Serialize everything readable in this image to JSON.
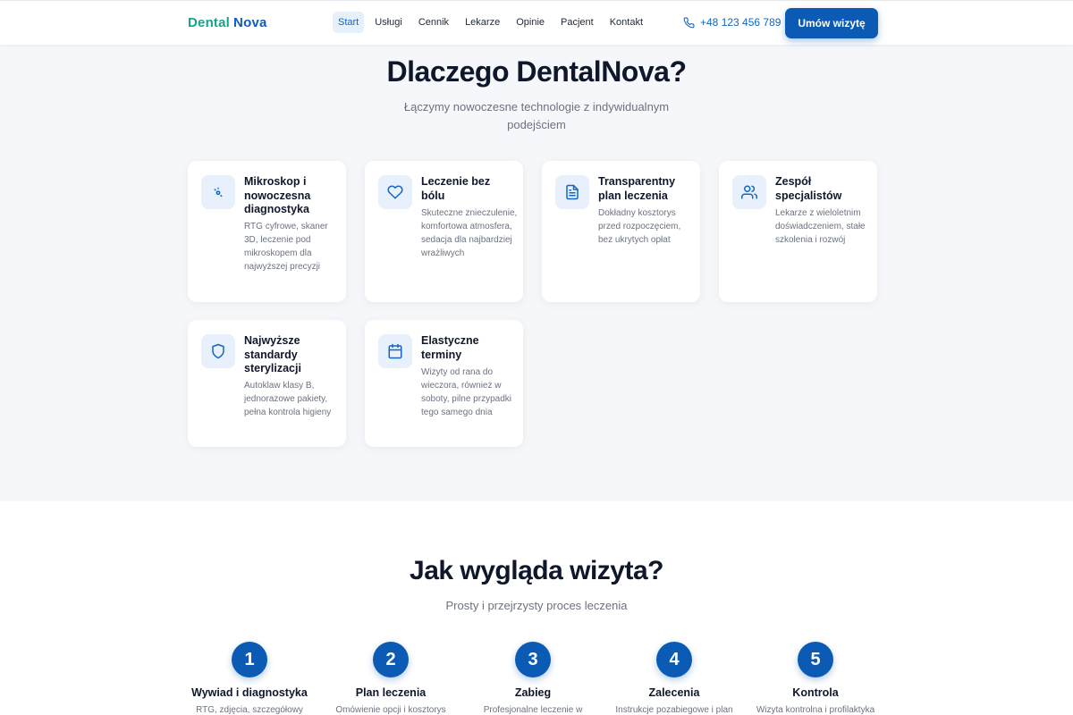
{
  "header": {
    "logo_part1": "Dental",
    "logo_part2": "Nova",
    "nav": [
      "Start",
      "Usługi",
      "Cennik",
      "Lekarze",
      "Opinie",
      "Pacjent",
      "Kontakt"
    ],
    "active_nav": "Start",
    "phone": "+48 123 456 789",
    "cta": "Umów wizytę"
  },
  "why": {
    "title": "Dlaczego DentalNova?",
    "subtitle": "Łączymy nowoczesne technologie z indywidualnym podejściem",
    "cards": [
      {
        "icon": "microscope-icon",
        "title": "Mikroskop i nowoczesna diagnostyka",
        "desc": "RTG cyfrowe, skaner 3D, leczenie pod mikroskopem dla najwyższej precyzji"
      },
      {
        "icon": "heart-icon",
        "title": "Leczenie bez bólu",
        "desc": "Skuteczne znieczulenie, komfortowa atmosfera, sedacja dla najbardziej wrażliwych"
      },
      {
        "icon": "document-icon",
        "title": "Transparentny plan leczenia",
        "desc": "Dokładny kosztorys przed rozpoczęciem, bez ukrytych opłat"
      },
      {
        "icon": "users-icon",
        "title": "Zespół specjalistów",
        "desc": "Lekarze z wieloletnim doświadczeniem, stałe szkolenia i rozwój"
      },
      {
        "icon": "shield-icon",
        "title": "Najwyższe standardy sterylizacji",
        "desc": "Autoklaw klasy B, jednorazowe pakiety, pełna kontrola higieny"
      },
      {
        "icon": "calendar-icon",
        "title": "Elastyczne terminy",
        "desc": "Wizyty od rana do wieczora, również w soboty, pilne przypadki tego samego dnia"
      }
    ]
  },
  "visit": {
    "title": "Jak wygląda wizyta?",
    "subtitle": "Prosty i przejrzysty proces leczenia",
    "steps": [
      {
        "num": "1",
        "title": "Wywiad i diagnostyka",
        "desc": "RTG, zdjęcia, szczegółowy"
      },
      {
        "num": "2",
        "title": "Plan leczenia",
        "desc": "Omówienie opcji i kosztorys"
      },
      {
        "num": "3",
        "title": "Zabieg",
        "desc": "Profesjonalne leczenie w"
      },
      {
        "num": "4",
        "title": "Zalecenia",
        "desc": "Instrukcje pozabiegowe i plan"
      },
      {
        "num": "5",
        "title": "Kontrola",
        "desc": "Wizyta kontrolna i profilaktyka"
      }
    ]
  },
  "colors": {
    "primary": "#0b5bb5",
    "logo_green": "#12a58a",
    "icon_bg": "#e8f0fb"
  }
}
